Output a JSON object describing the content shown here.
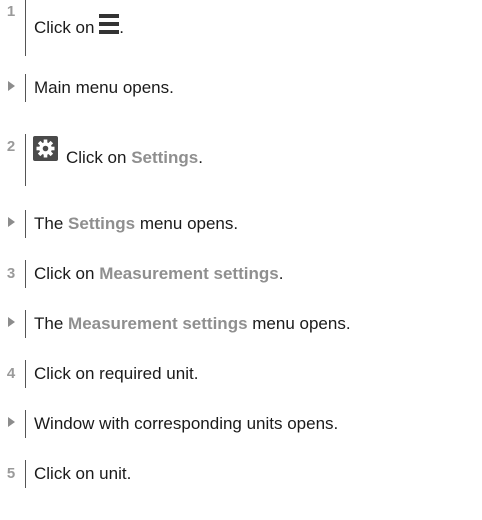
{
  "steps": [
    {
      "marker": "1",
      "prefix": "Click on",
      "suffix": "."
    },
    {
      "result": "Main menu opens."
    },
    {
      "marker": "2",
      "prefix": "Click on ",
      "highlight": "Settings",
      "suffix": "."
    },
    {
      "prefix": "The ",
      "highlight": "Settings",
      "suffix": " menu opens."
    },
    {
      "marker": "3",
      "prefix": "Click on ",
      "highlight": "Measurement settings",
      "suffix": "."
    },
    {
      "prefix": "The ",
      "highlight": "Measurement settings",
      "suffix": " menu opens."
    },
    {
      "marker": "4",
      "text": "Click on required unit."
    },
    {
      "text": "Window with corresponding units opens."
    },
    {
      "marker": "5",
      "text": "Click on unit."
    }
  ],
  "icons": {
    "menu": "hamburger-menu-icon",
    "settings": "gear-icon"
  },
  "colors": {
    "highlight": "#8f8f8f",
    "marker": "#9a9a9a",
    "text": "#1a1a1a"
  }
}
